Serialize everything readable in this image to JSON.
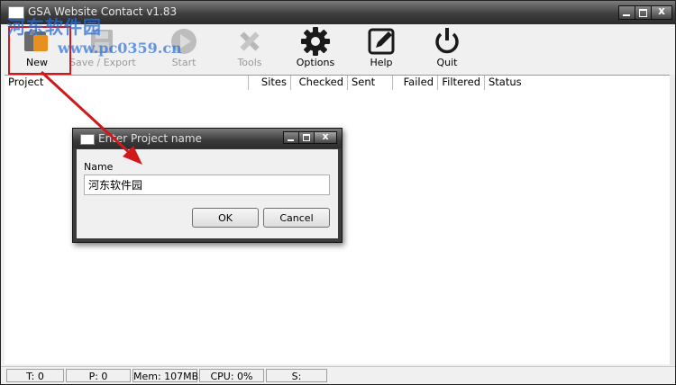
{
  "window": {
    "title": "GSA Website Contact v1.83",
    "close_glyph": "x"
  },
  "toolbar": {
    "buttons": [
      {
        "label": "New",
        "icon": "new-folder-icon",
        "enabled": true
      },
      {
        "label": "Save / Export",
        "icon": "save-export-icon",
        "enabled": false
      },
      {
        "label": "Start",
        "icon": "start-icon",
        "enabled": false
      },
      {
        "label": "Tools",
        "icon": "tools-icon",
        "enabled": false
      },
      {
        "label": "Options",
        "icon": "gear-icon",
        "enabled": true
      },
      {
        "label": "Help",
        "icon": "pencil-note-icon",
        "enabled": true
      },
      {
        "label": "Quit",
        "icon": "power-icon",
        "enabled": true
      }
    ],
    "highlight_color": "#d0191c"
  },
  "list": {
    "columns": [
      "Project",
      "Sites",
      "Checked",
      "Sent",
      "Failed",
      "Filtered",
      "Status"
    ],
    "rows": []
  },
  "statusbar": {
    "panels": [
      "T: 0",
      "P: 0",
      "Mem: 107MB",
      "CPU: 0%",
      "S:"
    ]
  },
  "dialog": {
    "title": "Enter Project name",
    "close_glyph": "x",
    "name_label": "Name",
    "name_value": "河东软件园",
    "ok_label": "OK",
    "cancel_label": "Cancel"
  },
  "watermark": {
    "line1": "河东软件园",
    "line2": "www.pc0359.cn",
    "color": "#286edc"
  },
  "annotation": {
    "arrow_color": "#d0191c"
  }
}
